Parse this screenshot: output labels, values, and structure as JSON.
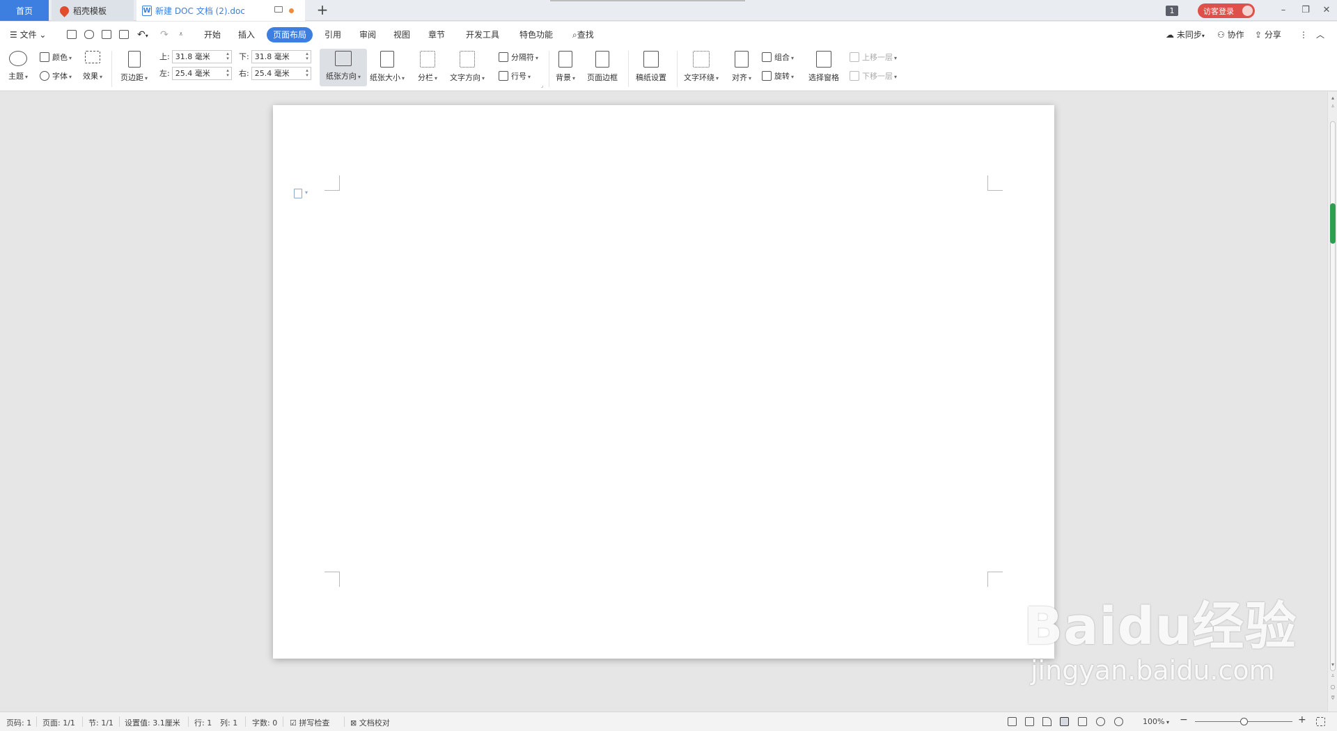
{
  "tabs": {
    "home": "首页",
    "template": "稻壳模板",
    "document": "新建 DOC 文档 (2).doc"
  },
  "topbar": {
    "badge": "1",
    "login": "访客登录"
  },
  "menu": {
    "file": "文件",
    "tabs": [
      "开始",
      "插入",
      "页面布局",
      "引用",
      "审阅",
      "视图",
      "章节",
      "开发工具",
      "特色功能"
    ],
    "active_tab": "页面布局",
    "search": "查找",
    "sync": "未同步",
    "collab": "协作",
    "share": "分享"
  },
  "ribbon": {
    "theme": "主题",
    "color": "颜色",
    "font": "字体",
    "effect": "效果",
    "margins": "页边距",
    "margin_top_label": "上:",
    "margin_top": "31.8 毫米",
    "margin_bottom_label": "下:",
    "margin_bottom": "31.8 毫米",
    "margin_left_label": "左:",
    "margin_left": "25.4 毫米",
    "margin_right_label": "右:",
    "margin_right": "25.4 毫米",
    "orientation": "纸张方向",
    "paper_size": "纸张大小",
    "columns": "分栏",
    "text_direction": "文字方向",
    "breaks": "分隔符",
    "line_numbers": "行号",
    "background": "背景",
    "page_border": "页面边框",
    "manuscript": "稿纸设置",
    "text_wrap": "文字环绕",
    "align": "对齐",
    "group": "组合",
    "rotate": "旋转",
    "selection_pane": "选择窗格",
    "bring_forward": "上移一层",
    "send_backward": "下移一层"
  },
  "status": {
    "page_num": "页码: 1",
    "page": "页面: 1/1",
    "section": "节: 1/1",
    "setting": "设置值: 3.1厘米",
    "row": "行: 1",
    "col": "列: 1",
    "words": "字数: 0",
    "spell": "拼写检查",
    "proof": "文档校对",
    "zoom": "100%"
  },
  "watermark": {
    "logo": "Baidu经验",
    "url": "jingyan.baidu.com"
  },
  "colors": {
    "accent": "#3c7fe0",
    "login": "#e0504a",
    "scroll_thumb": "#2f9e52"
  }
}
